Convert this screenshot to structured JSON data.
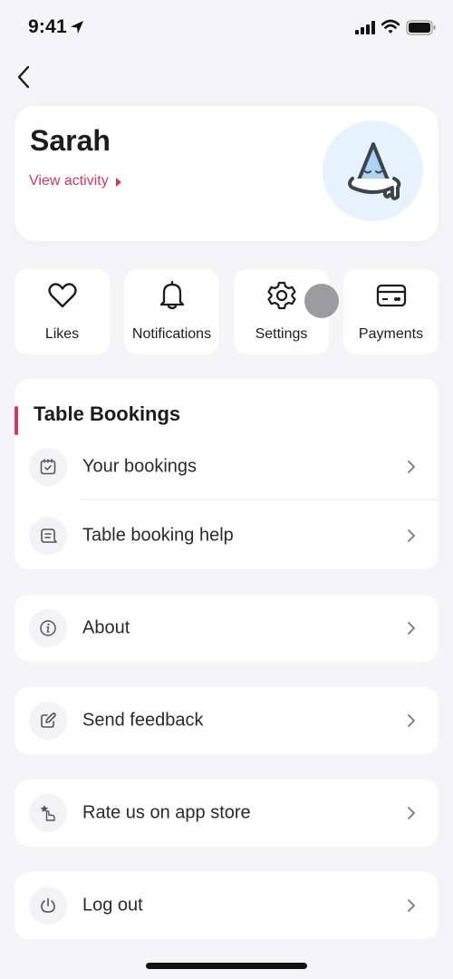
{
  "status_bar": {
    "time": "9:41",
    "icons": [
      "location-arrow-icon",
      "cellular-signal-icon",
      "wifi-icon",
      "battery-icon"
    ]
  },
  "nav": {
    "back_icon": "chevron-left-icon"
  },
  "profile": {
    "name": "Sarah",
    "view_activity_label": "View activity",
    "avatar_icon": "cone-mascot-avatar"
  },
  "quick_actions": [
    {
      "label": "Likes",
      "icon": "heart-icon"
    },
    {
      "label": "Notifications",
      "icon": "bell-icon"
    },
    {
      "label": "Settings",
      "icon": "gear-icon"
    },
    {
      "label": "Payments",
      "icon": "credit-card-icon"
    }
  ],
  "table_bookings": {
    "title": "Table Bookings",
    "items": [
      {
        "label": "Your bookings",
        "icon": "calendar-check-icon"
      },
      {
        "label": "Table booking help",
        "icon": "chat-help-icon"
      }
    ]
  },
  "menu": [
    {
      "label": "About",
      "icon": "info-icon"
    },
    {
      "label": "Send feedback",
      "icon": "edit-icon"
    },
    {
      "label": "Rate us on app store",
      "icon": "star-tap-icon"
    },
    {
      "label": "Log out",
      "icon": "power-icon"
    }
  ],
  "colors": {
    "accent": "#d5385f",
    "background": "#f5f4f7",
    "card": "#ffffff",
    "avatar_bg": "#e6f3fd"
  }
}
